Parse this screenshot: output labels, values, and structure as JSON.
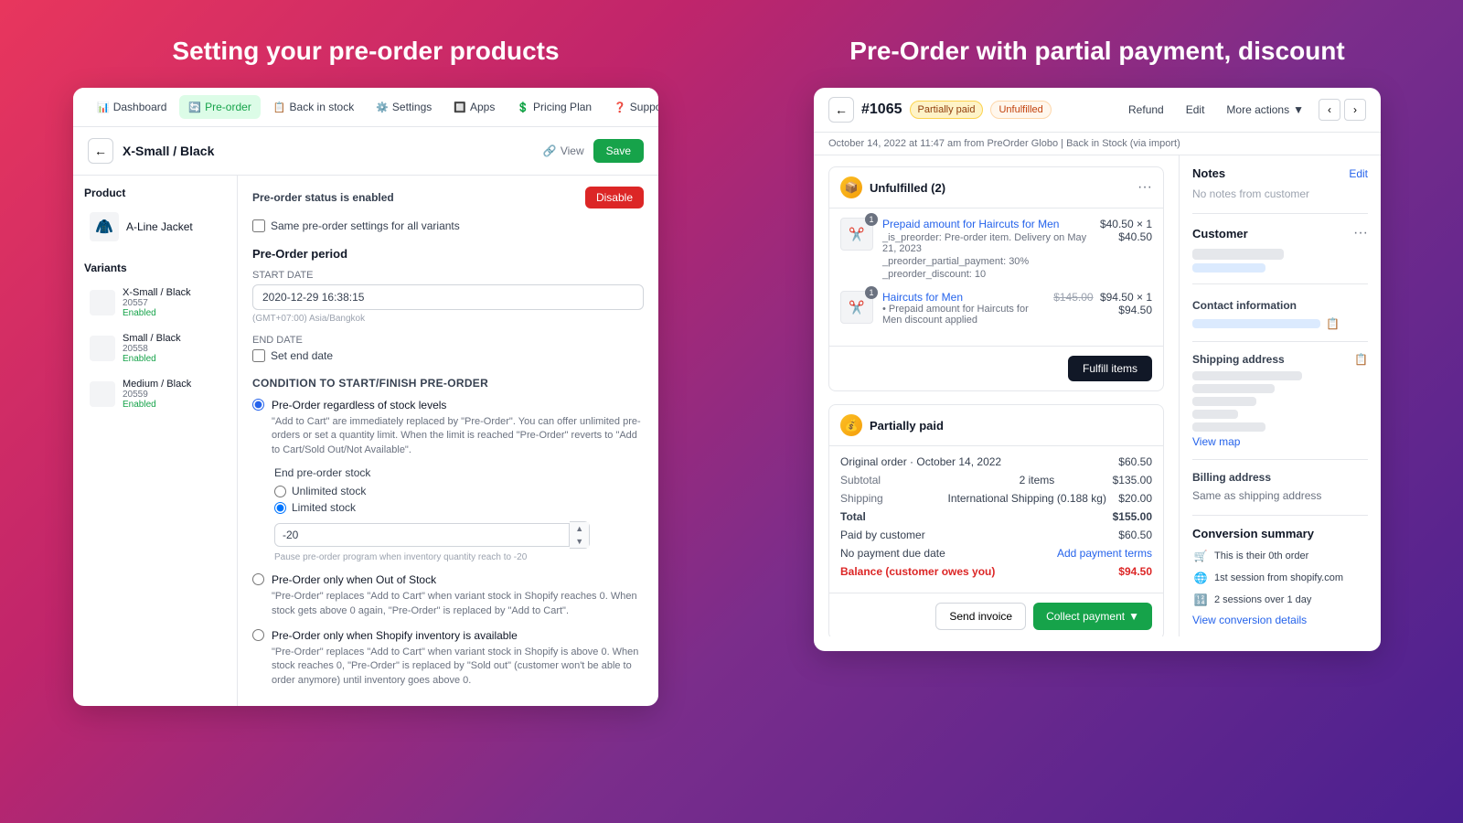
{
  "left": {
    "title": "Setting your pre-order products",
    "nav": {
      "items": [
        {
          "label": "Dashboard",
          "icon": "📊",
          "active": false
        },
        {
          "label": "Pre-order",
          "icon": "🔄",
          "active": true
        },
        {
          "label": "Back in stock",
          "icon": "📋",
          "active": false
        },
        {
          "label": "Settings",
          "icon": "⚙️",
          "active": false
        },
        {
          "label": "Apps",
          "icon": "🔲",
          "active": false
        },
        {
          "label": "Pricing Plan",
          "icon": "💲",
          "active": false
        },
        {
          "label": "Support",
          "icon": "❓",
          "active": false
        }
      ]
    },
    "product_header": {
      "back": "←",
      "title": "X-Small / Black",
      "view": "View",
      "save": "Save"
    },
    "product": {
      "section_title": "Product",
      "name": "A-Line Jacket"
    },
    "variants": {
      "section_title": "Variants",
      "items": [
        {
          "name": "X-Small / Black",
          "sku": "20557",
          "status": "Enabled"
        },
        {
          "name": "Small / Black",
          "sku": "20558",
          "status": "Enabled"
        },
        {
          "name": "Medium / Black",
          "sku": "20559",
          "status": "Enabled"
        }
      ]
    },
    "settings": {
      "status_text": "Pre-order status is",
      "status_value": "enabled",
      "disable_btn": "Disable",
      "same_settings_label": "Same pre-order settings for all variants",
      "period_title": "Pre-Order period",
      "start_date_label": "START DATE",
      "start_date_value": "2020-12-29 16:38:15",
      "timezone_hint": "(GMT+07:00) Asia/Bangkok",
      "end_date_label": "END DATE",
      "set_end_date": "Set end date",
      "condition_title": "CONDITION TO START/FINISH PRE-ORDER",
      "options": [
        {
          "id": "opt1",
          "label": "Pre-Order regardless of stock levels",
          "desc": "\"Add to Cart\" are immediately replaced by \"Pre-Order\". You can offer unlimited pre-orders or set a quantity limit. When the limit is reached \"Pre-Order\" reverts to \"Add to Cart/Sold Out/Not Available\".",
          "checked": true
        },
        {
          "id": "opt2",
          "label": "Pre-Order only when Out of Stock",
          "desc": "\"Pre-Order\" replaces \"Add to Cart\" when variant stock in Shopify reaches 0. When stock gets above 0 again, \"Pre-Order\" is replaced by \"Add to Cart\".",
          "checked": false
        },
        {
          "id": "opt3",
          "label": "Pre-Order only when Shopify inventory is available",
          "desc": "\"Pre-Order\" replaces \"Add to Cart\" when variant stock in Shopify is above 0. When stock reaches 0, \"Pre-Order\" is replaced by \"Sold out\" (customer won't be able to order anymore) until inventory goes above 0.",
          "checked": false
        }
      ],
      "end_pre_order_stock_label": "End pre-order stock",
      "unlimited_stock": "Unlimited stock",
      "limited_stock": "Limited stock",
      "limited_value": "-20",
      "pause_hint": "Pause pre-order program when inventory quantity reach to -20"
    }
  },
  "right": {
    "title": "Pre-Order with partial payment, discount",
    "order": {
      "back": "←",
      "number": "#1065",
      "badge_paid": "Partially paid",
      "badge_unfulfilled": "Unfulfilled",
      "actions": {
        "refund": "Refund",
        "edit": "Edit",
        "more": "More actions"
      },
      "date": "October 14, 2022 at 11:47 am from PreOrder Globo | Back in Stock (via import)",
      "fulfillment": {
        "title": "Unfulfilled (2)",
        "items": [
          {
            "name": "Prepaid amount for Haircuts for Men",
            "price": "$40.50",
            "qty": "× 1",
            "total": "$40.50",
            "meta1": "_is_preorder: Pre-order item. Delivery on May 21, 2023",
            "meta2": "_preorder_partial_payment: 30%",
            "meta3": "_preorder_discount: 10",
            "has_original": false
          },
          {
            "name": "Haircuts for Men",
            "price": "$94.50",
            "original_price": "$145.00",
            "qty": "× 1",
            "total": "$94.50",
            "sub_detail": "Prepaid amount for Haircuts for Men discount applied",
            "has_original": true
          }
        ],
        "fulfill_btn": "Fulfill items"
      },
      "payment": {
        "title": "Partially paid",
        "original_order": "Original order · October 14, 2022",
        "original_amount": "$60.50",
        "subtotal_label": "Subtotal",
        "subtotal_items": "2 items",
        "subtotal_amount": "$135.00",
        "shipping_label": "Shipping",
        "shipping_detail": "International Shipping (0.188 kg)",
        "shipping_amount": "$20.00",
        "total_label": "Total",
        "total_amount": "$155.00",
        "paid_label": "Paid by customer",
        "paid_amount": "$60.50",
        "no_payment_label": "No payment due date",
        "add_terms": "Add payment terms",
        "balance_label": "Balance (customer owes you)",
        "balance_amount": "$94.50",
        "send_invoice_btn": "Send invoice",
        "collect_btn": "Collect payment"
      },
      "sidebar": {
        "notes_title": "Notes",
        "edit_label": "Edit",
        "notes_empty": "No notes from customer",
        "customer_title": "Customer",
        "contact_title": "Contact information",
        "shipping_title": "Shipping address",
        "view_map": "View map",
        "billing_title": "Billing address",
        "billing_same": "Same as shipping address",
        "conversion_title": "Conversion summary",
        "conversion_items": [
          {
            "icon": "🛒",
            "text": "This is their 0th order"
          },
          {
            "icon": "🌐",
            "text": "1st session from shopify.com"
          },
          {
            "icon": "🔢",
            "text": "2 sessions over 1 day"
          }
        ],
        "view_conversion": "View conversion details"
      }
    }
  }
}
